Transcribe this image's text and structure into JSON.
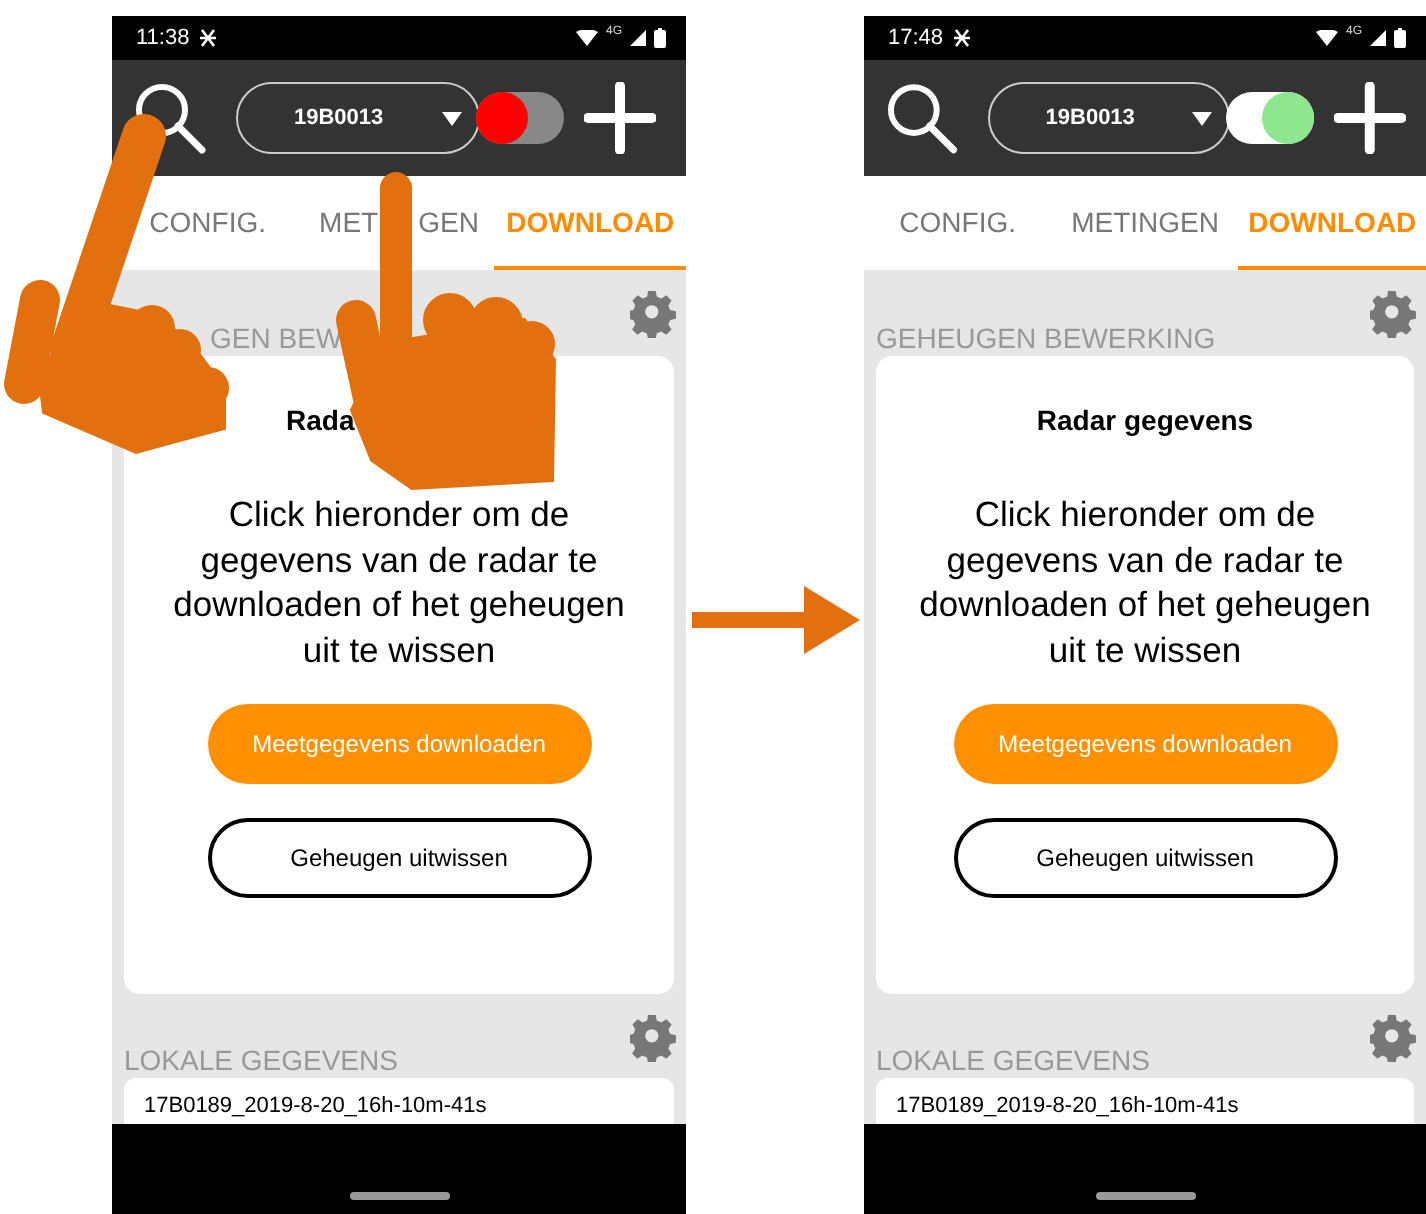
{
  "screens": [
    {
      "hands": true,
      "status_bar": {
        "time": "11:38",
        "network": "4G"
      },
      "device_select": {
        "value": "19B0013"
      },
      "connection_toggle": {
        "on": false
      },
      "tabs": [
        {
          "label": "CONFIG.",
          "selected": false
        },
        {
          "label_parts": [
            "MET",
            "GEN"
          ],
          "selected": false
        },
        {
          "label": "DOWNLOAD",
          "selected": true
        }
      ],
      "memory_section": {
        "title": "GEN BEW",
        "card_title": "Rada",
        "message": "Click hieronder om de gegevens van de radar te downloaden of het geheugen uit te wissen",
        "buttons": [
          {
            "label": "Meetgegevens downloaden",
            "kind": "primary"
          },
          {
            "label": "Geheugen uitwissen",
            "kind": "outline"
          }
        ]
      },
      "local_section": {
        "title": "LOKALE GEGEVENS",
        "files": [
          "17B0189_2019-8-20_16h-10m-41s"
        ]
      }
    },
    {
      "hands": false,
      "status_bar": {
        "time": "17:48",
        "network": "4G"
      },
      "device_select": {
        "value": "19B0013"
      },
      "connection_toggle": {
        "on": true
      },
      "tabs": [
        {
          "label": "CONFIG.",
          "selected": false
        },
        {
          "label": "METINGEN",
          "selected": false
        },
        {
          "label": "DOWNLOAD",
          "selected": true
        }
      ],
      "memory_section": {
        "title": "GEHEUGEN BEWERKING",
        "card_title": "Radar gegevens",
        "message": "Click hieronder om de gegevens van de radar te downloaden of het geheugen uit te wissen",
        "buttons": [
          {
            "label": "Meetgegevens downloaden",
            "kind": "primary"
          },
          {
            "label": "Geheugen uitwissen",
            "kind": "outline"
          }
        ]
      },
      "local_section": {
        "title": "LOKALE GEGEVENS",
        "files": [
          "17B0189_2019-8-20_16h-10m-41s"
        ]
      }
    }
  ]
}
